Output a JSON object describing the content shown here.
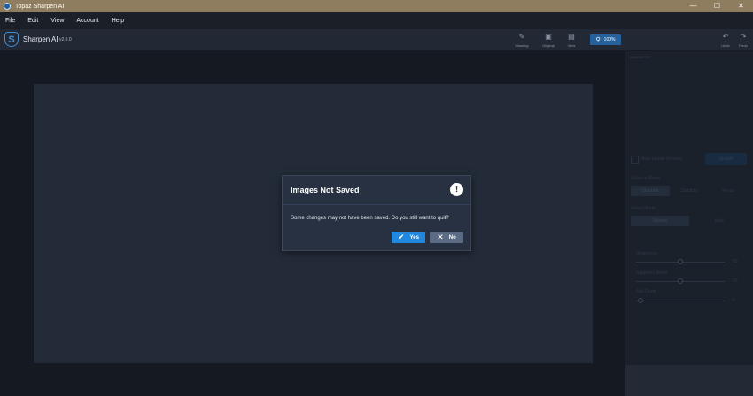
{
  "window": {
    "title": "Topaz Sharpen AI",
    "controls": [
      "—",
      "☐",
      "✕"
    ]
  },
  "menu": [
    "File",
    "Edit",
    "View",
    "Account",
    "Help"
  ],
  "app": {
    "name": "Sharpen AI",
    "version": "v2.0.0",
    "logo_letter": "S"
  },
  "toolbar": {
    "tools": [
      {
        "icon": "brush-icon",
        "glyph": "✎",
        "label": "Masking"
      },
      {
        "icon": "image-icon",
        "glyph": "▣",
        "label": "Original"
      },
      {
        "icon": "view-icon",
        "glyph": "▤",
        "label": "View"
      }
    ],
    "zoom": "100%",
    "undo": "Undo",
    "redo": "Redo"
  },
  "panel": {
    "preview_title": "NAVIGATOR",
    "auto_update": "Auto update preview",
    "update_button": "Update",
    "select_model": "Select a Model",
    "models": [
      "Sharpen",
      "Stabilize",
      "Focus"
    ],
    "select_mode": "Select Mode",
    "modes": [
      "Manual",
      "Auto"
    ],
    "sliders": [
      {
        "label": "Sharpness",
        "value": "50",
        "fraction": 0.5
      },
      {
        "label": "Suppress Noise",
        "value": "50",
        "fraction": 0.5
      },
      {
        "label": "Add Grain",
        "value": "0",
        "fraction": 0.0
      }
    ]
  },
  "dialog": {
    "title": "Images Not Saved",
    "message": "Some changes may not have been saved. Do you still want to quit?",
    "yes_label": "Yes",
    "no_label": "No"
  },
  "colors": {
    "accent": "#2188e0",
    "no_button": "#5b6b83",
    "titlebar": "#8f7d60"
  }
}
